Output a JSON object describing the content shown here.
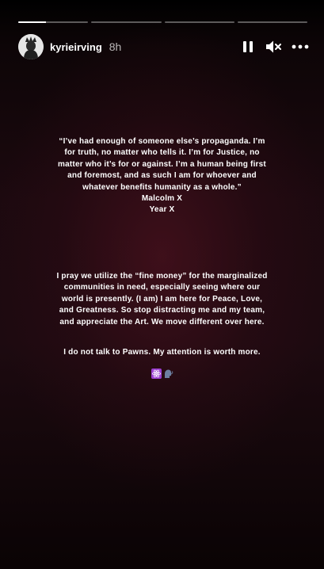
{
  "progress": {
    "segments": [
      {
        "fill": 0.4
      },
      {
        "fill": 0
      },
      {
        "fill": 0
      },
      {
        "fill": 0
      }
    ]
  },
  "header": {
    "username": "kyrieirving",
    "time": "8h",
    "icons": [
      "pause-icon",
      "mute-icon",
      "more-icon"
    ]
  },
  "story": {
    "quote": "“I’ve had enough of someone else’s propaganda. I’m\nfor truth, no matter who tells it. I’m for Justice, no\nmatter  who it’s for or against. I’m a human being first\nand foremost,  and as such  I am for whoever and\nwhatever benefits humanity as a whole.”",
    "attribution_name": "Malcolm X",
    "attribution_book": "Year X",
    "message": "I pray we utilize the “fine money” for the marginalized\ncommunities in need, especially seeing where our\nworld is presently. (I am) I am here for Peace, Love,\nand Greatness. So stop distracting me and my team,\nand appreciate the Art. We move different over here.",
    "pawns": "I do not talk to Pawns. My attention is worth more.",
    "emojis": [
      "atom-symbol-icon",
      "speaking-head-icon"
    ]
  },
  "colors": {
    "background": "#1c090f",
    "text": "#ffffff",
    "emoji_atom_bg": "#9b3fd1"
  }
}
